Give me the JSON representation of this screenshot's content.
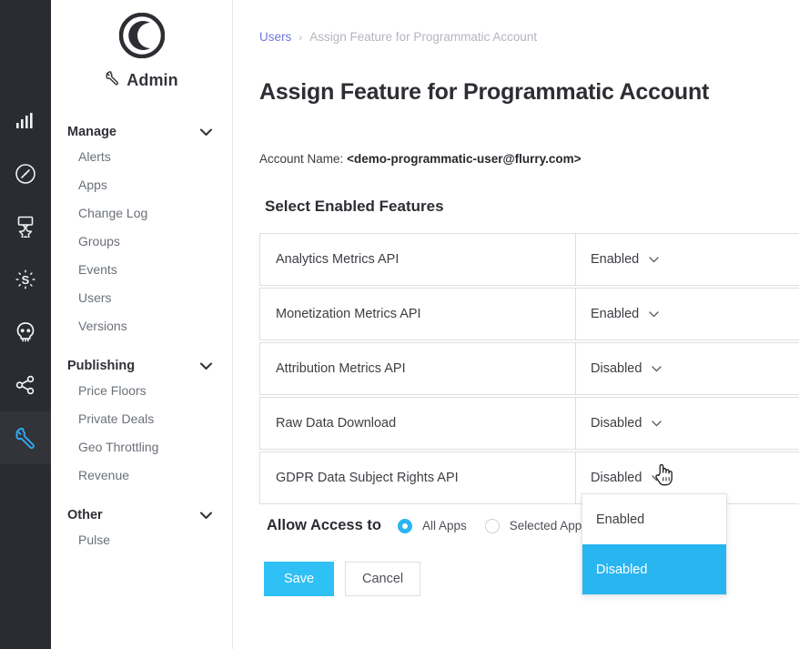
{
  "rail": {
    "items": [
      {
        "name": "analytics-bar-chart-icon",
        "label": "Analytics",
        "active": false
      },
      {
        "name": "compass-icon",
        "label": "Explorer",
        "active": false
      },
      {
        "name": "medal-award-icon",
        "label": "Awards",
        "active": false
      },
      {
        "name": "dollar-sparkle-icon",
        "label": "Monetization",
        "active": false
      },
      {
        "name": "skull-icon",
        "label": "Crash",
        "active": false
      },
      {
        "name": "share-nodes-icon",
        "label": "Attribution",
        "active": false
      },
      {
        "name": "wrench-icon",
        "label": "Admin",
        "active": true
      }
    ],
    "active_color": "#2fa8f0"
  },
  "nav": {
    "logo_name": "flurry-circle-logo",
    "title": "Admin",
    "title_icon": "wrench-icon",
    "sections": [
      {
        "label": "Manage",
        "items": [
          "Alerts",
          "Apps",
          "Change Log",
          "Groups",
          "Events",
          "Users",
          "Versions"
        ]
      },
      {
        "label": "Publishing",
        "items": [
          "Price Floors",
          "Private Deals",
          "Geo Throttling",
          "Revenue"
        ]
      },
      {
        "label": "Other",
        "items": [
          "Pulse"
        ]
      }
    ]
  },
  "breadcrumb": {
    "link": "Users",
    "separator": "›",
    "current": "Assign Feature for Programmatic Account"
  },
  "page": {
    "title": "Assign Feature for Programmatic Account",
    "account_label": "Account Name:",
    "account_value": "<demo-programmatic-user@flurry.com>",
    "section_title": "Select Enabled Features"
  },
  "features": [
    {
      "name": "Analytics Metrics API",
      "state": "Enabled"
    },
    {
      "name": "Monetization Metrics API",
      "state": "Enabled"
    },
    {
      "name": "Attribution Metrics API",
      "state": "Disabled"
    },
    {
      "name": "Raw Data Download",
      "state": "Disabled"
    },
    {
      "name": "GDPR Data Subject Rights API",
      "state": "Disabled"
    }
  ],
  "allow_access": {
    "label": "Allow Access to",
    "options": [
      {
        "label": "All Apps",
        "selected": true
      },
      {
        "label": "Selected Apps",
        "selected": false
      }
    ]
  },
  "buttons": {
    "save": "Save",
    "cancel": "Cancel"
  },
  "dropdown": {
    "open_for": "GDPR Data Subject Rights API",
    "options": [
      {
        "label": "Enabled",
        "selected": false
      },
      {
        "label": "Disabled",
        "selected": true
      }
    ]
  },
  "colors": {
    "accent": "#2fc0f5",
    "accent_alt": "#29b6f0",
    "rail_bg": "#2a2c31",
    "rail_active_bg": "#323439",
    "link": "#6f7ae0",
    "border": "#dcdfe2",
    "text": "#3c3e43"
  },
  "cursor": {
    "type": "pointing-hand"
  }
}
